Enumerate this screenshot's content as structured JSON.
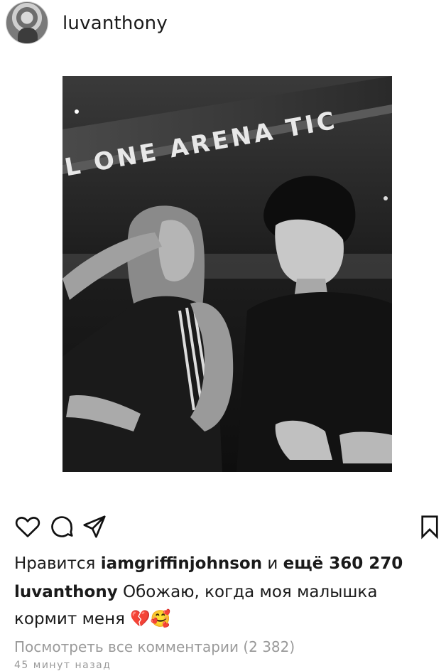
{
  "header": {
    "username": "luvanthony",
    "avatar_icon": "profile-avatar"
  },
  "photo": {
    "sign_text": "L ONE ARENA TIC",
    "description_icon": "post-photo"
  },
  "actions": {
    "like_icon": "heart-icon",
    "comment_icon": "comment-icon",
    "share_icon": "send-icon",
    "save_icon": "bookmark-icon"
  },
  "likes": {
    "prefix": "Нравится",
    "user": "iamgriffinjohnson",
    "middle": "и",
    "count": "ещё 360 270"
  },
  "caption": {
    "user": "luvanthony",
    "text": "Обожаю, когда моя малышка кормит меня",
    "emojis": "💔🥰"
  },
  "comments_link": "Посмотреть все комментарии (2 382)",
  "time_ago": "45 минут назад"
}
